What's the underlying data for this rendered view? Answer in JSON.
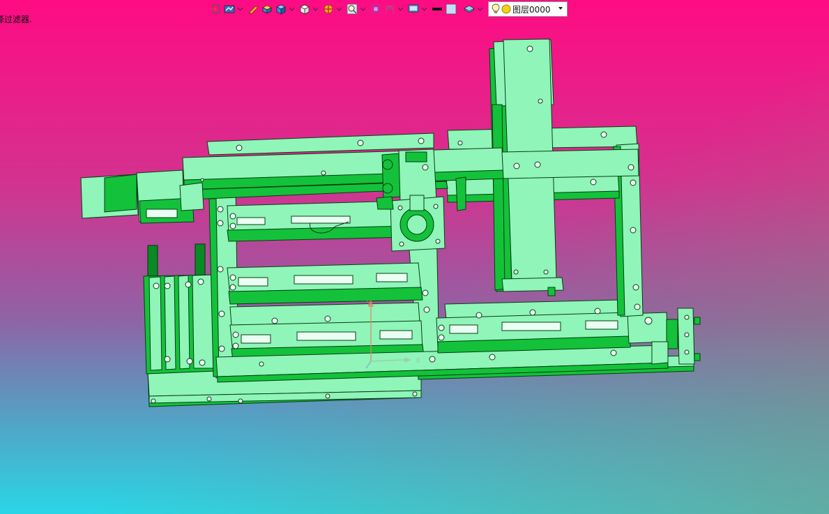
{
  "app": {
    "status_text": "择过滤器.",
    "layer_selector": {
      "value": "图层0000",
      "icons": [
        "lightbulb-icon",
        "layer-status-circle-icon"
      ]
    }
  },
  "toolbar": {
    "items": [
      {
        "name": "snap-tool",
        "icon": "snap-icon",
        "has_dropdown": false
      },
      {
        "name": "display-mode",
        "icon": "display-mode-icon",
        "has_dropdown": true
      },
      {
        "name": "sketch-tool",
        "icon": "pencil-icon",
        "has_dropdown": false
      },
      {
        "name": "solid-tool",
        "icon": "solid-box-icon",
        "has_dropdown": false
      },
      {
        "name": "shaded-view",
        "icon": "shaded-cube-icon",
        "has_dropdown": true
      },
      {
        "name": "view-orientation",
        "icon": "view-cube-icon",
        "has_dropdown": true
      },
      {
        "name": "section-view",
        "icon": "section-icon",
        "has_dropdown": true
      },
      {
        "name": "zoom",
        "icon": "zoom-icon",
        "has_dropdown": true
      },
      {
        "name": "fit-view",
        "icon": "fit-icon",
        "has_dropdown": false
      },
      {
        "name": "measure",
        "icon": "measure-icon",
        "has_dropdown": true
      },
      {
        "name": "display-settings",
        "icon": "monitor-icon",
        "has_dropdown": true
      },
      {
        "name": "line-color",
        "icon": "color-black-swatch-icon",
        "has_dropdown": false
      },
      {
        "name": "fill-color",
        "icon": "color-lightblue-swatch-icon",
        "has_dropdown": false
      },
      {
        "name": "layer-manager",
        "icon": "layers-icon",
        "has_dropdown": true
      }
    ]
  },
  "viewport": {
    "background_top": "#ff0b83",
    "background_bottom": "#2ad6e6",
    "model_face_color": "#8ff5b9",
    "model_edge_color": "#05b82c",
    "triad_labels": {
      "y": "Y",
      "x": "X"
    }
  }
}
